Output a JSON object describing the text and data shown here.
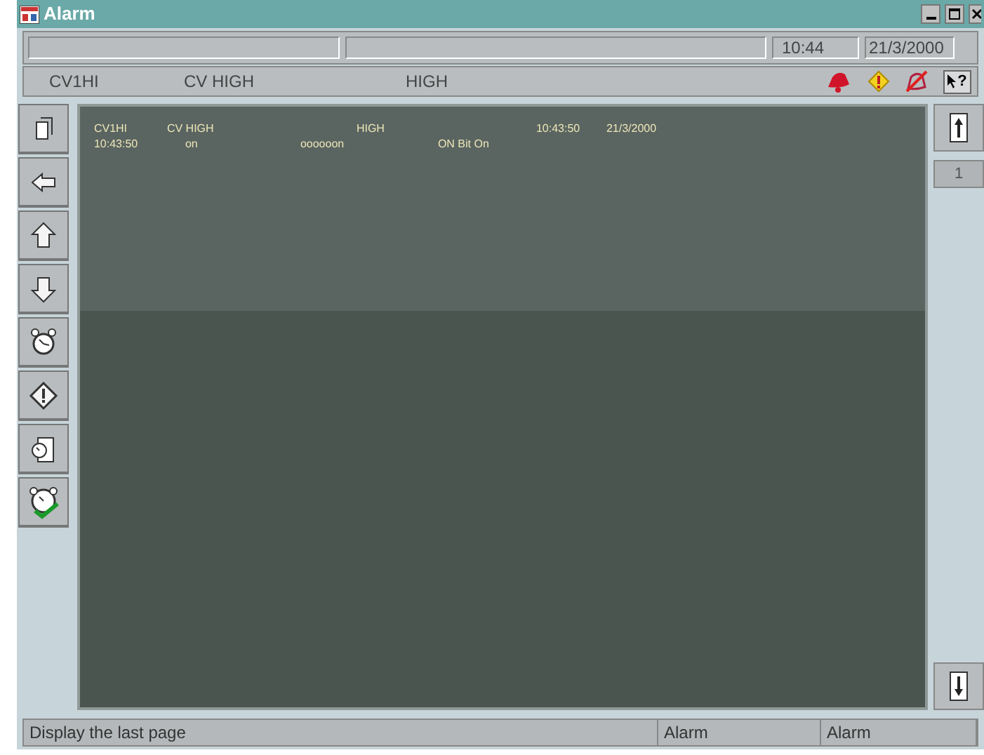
{
  "window": {
    "title": "Alarm"
  },
  "clock": {
    "time": "10:44",
    "date": "21/3/2000"
  },
  "current_alarm": {
    "tag": "CV1HI",
    "description": "CV HIGH",
    "state": "HIGH"
  },
  "help_button": {
    "label": "?"
  },
  "alarm_list": {
    "lines": [
      {
        "cells": [
          "CV1HI",
          "CV HIGH",
          "HIGH",
          "10:43:50",
          "21/3/2000"
        ]
      },
      {
        "cells": [
          "10:43:50",
          "on",
          "oooooon",
          "ON Bit On"
        ]
      }
    ]
  },
  "page_number": "1",
  "status_bar": [
    "Display the last page",
    "Alarm",
    "Alarm"
  ]
}
